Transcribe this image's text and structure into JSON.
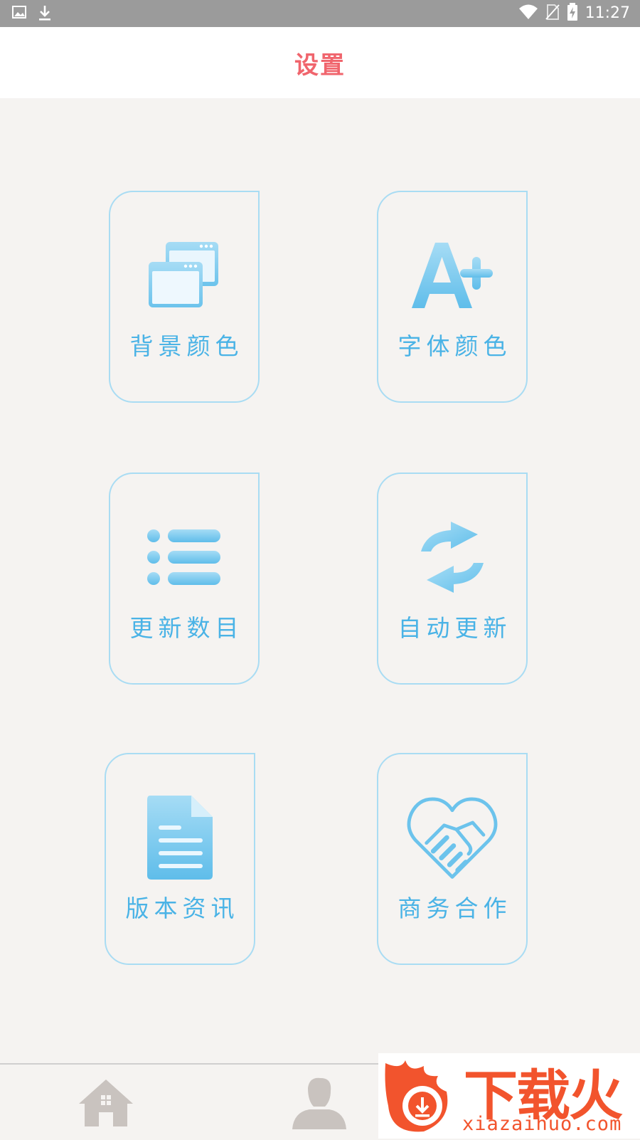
{
  "status_bar": {
    "time": "11:27",
    "icons": [
      "image-icon",
      "download-icon",
      "wifi-icon",
      "no-sim-icon",
      "battery-charging-icon"
    ]
  },
  "header": {
    "title": "设置"
  },
  "tiles": [
    {
      "label": "背景颜色",
      "icon": "windows-icon"
    },
    {
      "label": "字体颜色",
      "icon": "font-plus-icon"
    },
    {
      "label": "更新数目",
      "icon": "list-icon"
    },
    {
      "label": "自动更新",
      "icon": "refresh-icon"
    },
    {
      "label": "版本资讯",
      "icon": "document-icon"
    },
    {
      "label": "商务合作",
      "icon": "handshake-heart-icon"
    }
  ],
  "bottom_nav": [
    {
      "icon": "home-icon"
    },
    {
      "icon": "user-icon"
    }
  ],
  "watermark": {
    "brand": "下载火",
    "domain": "xiazaihuo.com"
  },
  "colors": {
    "title": "#f0656d",
    "accent_blue": "#4ab3e6",
    "tile_border": "#a9dcf3",
    "background": "#f5f3f1",
    "watermark": "#f2542d"
  }
}
